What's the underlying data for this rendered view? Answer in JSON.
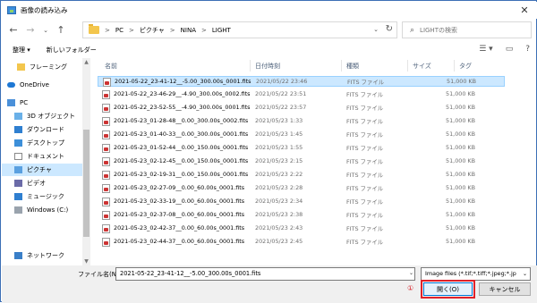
{
  "window": {
    "title": "画像の読み込み",
    "close_glyph": "✕"
  },
  "nav": {
    "back": "←",
    "forward": "→",
    "recent": "⌄",
    "up": "↑"
  },
  "address": {
    "crumbs": [
      "PC",
      "ピクチャ",
      "NINA",
      "LIGHT"
    ],
    "sep": ">",
    "dropdown": "⌄",
    "refresh": "↻"
  },
  "search": {
    "placeholder": "LIGHTの検索",
    "glyph": "⌕"
  },
  "toolbar": {
    "organize": "整理 ▾",
    "new_folder": "新しいフォルダー",
    "view": "☰ ▾",
    "pane": "▭",
    "help": "?"
  },
  "sidebar": {
    "items": [
      {
        "label": "フレーミング",
        "icon": "folder-icon"
      },
      {
        "label": "OneDrive",
        "icon": "cloud-icon"
      },
      {
        "label": "PC",
        "icon": "computer-icon"
      },
      {
        "label": "3D オブジェクト",
        "icon": "cube-icon"
      },
      {
        "label": "ダウンロード",
        "icon": "download-icon"
      },
      {
        "label": "デスクトップ",
        "icon": "desktop-icon"
      },
      {
        "label": "ドキュメント",
        "icon": "document-icon"
      },
      {
        "label": "ピクチャ",
        "icon": "pictures-icon"
      },
      {
        "label": "ビデオ",
        "icon": "video-icon"
      },
      {
        "label": "ミュージック",
        "icon": "music-icon"
      },
      {
        "label": "Windows (C:)",
        "icon": "drive-icon"
      },
      {
        "label": "ネットワーク",
        "icon": "network-icon"
      }
    ]
  },
  "columns": {
    "name": "名前",
    "date": "日付時刻",
    "type": "種類",
    "size": "サイズ",
    "tag": "タグ"
  },
  "files": [
    {
      "name": "2021-05-22_23-41-12__-5.00_300.00s_0001.fits",
      "date": "2021/05/22 23:46",
      "type": "FITS ファイル",
      "size": "51,000 KB"
    },
    {
      "name": "2021-05-22_23-46-29__-4.90_300.00s_0002.fits",
      "date": "2021/05/22 23:51",
      "type": "FITS ファイル",
      "size": "51,000 KB"
    },
    {
      "name": "2021-05-22_23-52-55__-4.90_300.00s_0001.fits",
      "date": "2021/05/22 23:57",
      "type": "FITS ファイル",
      "size": "51,000 KB"
    },
    {
      "name": "2021-05-23_01-28-48__0.00_300.00s_0002.fits",
      "date": "2021/05/23 1:33",
      "type": "FITS ファイル",
      "size": "51,000 KB"
    },
    {
      "name": "2021-05-23_01-40-33__0.00_300.00s_0001.fits",
      "date": "2021/05/23 1:45",
      "type": "FITS ファイル",
      "size": "51,000 KB"
    },
    {
      "name": "2021-05-23_01-52-44__0.00_150.00s_0001.fits",
      "date": "2021/05/23 1:55",
      "type": "FITS ファイル",
      "size": "51,000 KB"
    },
    {
      "name": "2021-05-23_02-12-45__0.00_150.00s_0001.fits",
      "date": "2021/05/23 2:15",
      "type": "FITS ファイル",
      "size": "51,000 KB"
    },
    {
      "name": "2021-05-23_02-19-31__0.00_150.00s_0001.fits",
      "date": "2021/05/23 2:22",
      "type": "FITS ファイル",
      "size": "51,000 KB"
    },
    {
      "name": "2021-05-23_02-27-09__0.00_60.00s_0001.fits",
      "date": "2021/05/23 2:28",
      "type": "FITS ファイル",
      "size": "51,000 KB"
    },
    {
      "name": "2021-05-23_02-33-19__0.00_60.00s_0001.fits",
      "date": "2021/05/23 2:34",
      "type": "FITS ファイル",
      "size": "51,000 KB"
    },
    {
      "name": "2021-05-23_02-37-08__0.00_60.00s_0001.fits",
      "date": "2021/05/23 2:38",
      "type": "FITS ファイル",
      "size": "51,000 KB"
    },
    {
      "name": "2021-05-23_02-42-37__0.00_60.00s_0001.fits",
      "date": "2021/05/23 2:43",
      "type": "FITS ファイル",
      "size": "51,000 KB"
    },
    {
      "name": "2021-05-23_02-44-37__0.00_60.00s_0001.fits",
      "date": "2021/05/23 2:45",
      "type": "FITS ファイル",
      "size": "51,000 KB"
    }
  ],
  "footer": {
    "filename_label": "ファイル名(N):",
    "filename_value": "2021-05-22_23-41-12__-5.00_300.00s_0001.fits",
    "filter_value": "Image files (*.tif;*.tiff;*.jpeg;*.jp",
    "dropdown": "⌄",
    "open_label": "開く(O)",
    "cancel_label": "キャンセル",
    "step_marker": "①"
  },
  "colors": {
    "accent": "#0078d7",
    "selection": "#cce8ff",
    "highlight": "#e0212a"
  }
}
